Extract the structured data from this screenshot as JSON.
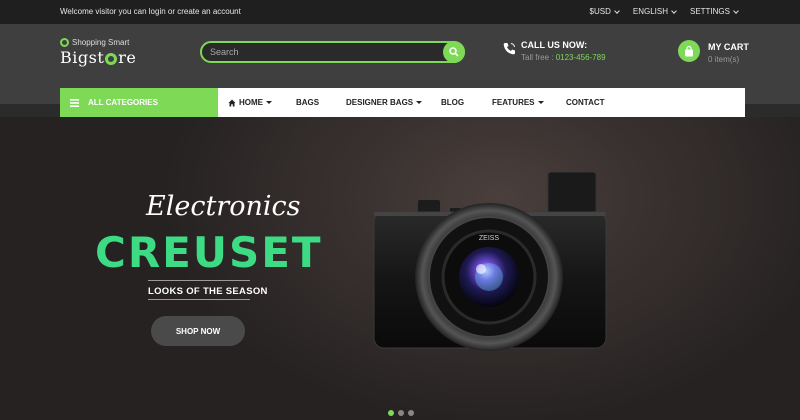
{
  "topbar": {
    "welcome": "Welcome visitor you can login or create an account",
    "currency": "$USD",
    "language": "ENGLISH",
    "settings": "SETTINGS"
  },
  "header": {
    "logo_tagline": "Shopping Smart",
    "logo_name_left": "Bigst",
    "logo_name_right": "re",
    "search_placeholder": "Search",
    "call_title": "CALL US NOW:",
    "call_label": "Tall free :",
    "call_number": "0123-456-789",
    "cart_title": "MY CART",
    "cart_count": "0 item(s)"
  },
  "nav": {
    "all_categories": "ALL CATEGORIES",
    "items": [
      "HOME",
      "BAGS",
      "DESIGNER BAGS",
      "BLOG",
      "FEATURES",
      "CONTACT"
    ]
  },
  "hero": {
    "script": "Electronics",
    "title": "CREUSET",
    "subtitle": "LOOKS OF THE SEASON",
    "cta": "SHOP NOW",
    "lens_brand": "ZEISS",
    "slides": 3,
    "active_slide": 1
  },
  "colors": {
    "accent": "#7ed957",
    "hero_title": "#3ddc84",
    "topbar_bg": "#1f1f1f",
    "header_bg": "#3f3f3f"
  }
}
